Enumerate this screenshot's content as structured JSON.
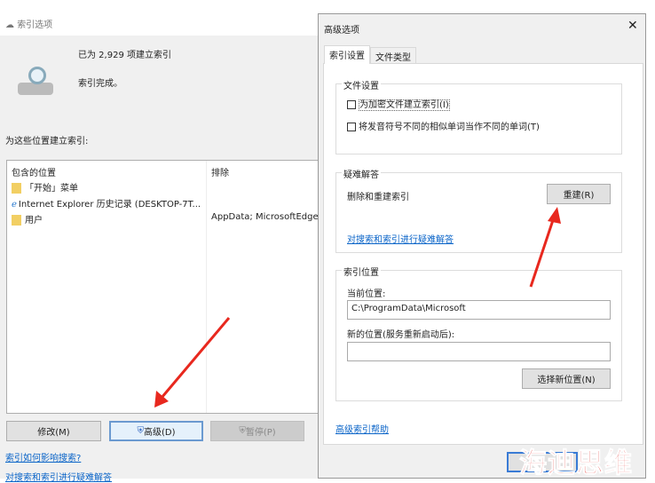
{
  "left_window": {
    "title": "索引选项",
    "indexed_count": "已为 2,929 项建立索引",
    "status": "索引完成。",
    "locations_label": "为这些位置建立索引:",
    "columns": [
      "包含的位置",
      "排除"
    ],
    "rows": [
      {
        "location": "「开始」菜单",
        "exclude": ""
      },
      {
        "location": "Internet Explorer 历史记录 (DESKTOP-7T...",
        "exclude": ""
      },
      {
        "location": "用户",
        "exclude": "AppData; MicrosoftEdge"
      }
    ],
    "buttons": {
      "modify": "修改(M)",
      "advanced": "高级(D)",
      "pause": "暂停(P)"
    },
    "links": [
      "索引如何影响搜索?",
      "对搜索和索引进行疑难解答"
    ]
  },
  "dialog": {
    "title": "高级选项",
    "tabs": [
      "索引设置",
      "文件类型"
    ],
    "file_settings": {
      "label": "文件设置",
      "options": [
        {
          "label": "为加密文件建立索引(I)",
          "checked": false
        },
        {
          "label": "将发音符号不同的相似单词当作不同的单词(T)",
          "checked": false
        }
      ]
    },
    "troubleshoot": {
      "label": "疑难解答",
      "rebuild_text": "删除和重建索引",
      "rebuild_button": "重建(R)",
      "link": "对搜索和索引进行疑难解答"
    },
    "location": {
      "label": "索引位置",
      "current_label": "当前位置:",
      "current_value": "C:\\ProgramData\\Microsoft",
      "new_label": "新的位置(服务重新启动后):",
      "new_value": "",
      "select_button": "选择新位置(N)"
    },
    "help_link": "高级索引帮助"
  },
  "watermark": "海迪思维",
  "colors": {
    "arrow": "#e8281e",
    "link": "#0a64c8",
    "watermark": "#e0201c"
  }
}
